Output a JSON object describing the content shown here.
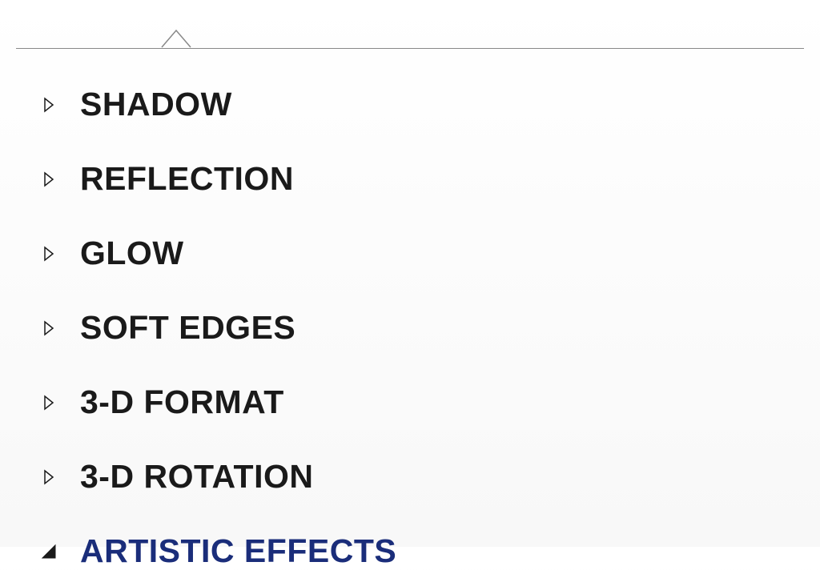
{
  "menu": {
    "items": [
      {
        "label": "SHADOW",
        "expanded": false,
        "selected": false
      },
      {
        "label": "REFLECTION",
        "expanded": false,
        "selected": false
      },
      {
        "label": "GLOW",
        "expanded": false,
        "selected": false
      },
      {
        "label": "SOFT EDGES",
        "expanded": false,
        "selected": false
      },
      {
        "label": "3-D FORMAT",
        "expanded": false,
        "selected": false
      },
      {
        "label": "3-D ROTATION",
        "expanded": false,
        "selected": false
      },
      {
        "label": "ARTISTIC EFFECTS",
        "expanded": true,
        "selected": true
      }
    ]
  },
  "colors": {
    "text_default": "#1a1a1a",
    "text_selected": "#1a2d7a",
    "divider": "#888"
  }
}
